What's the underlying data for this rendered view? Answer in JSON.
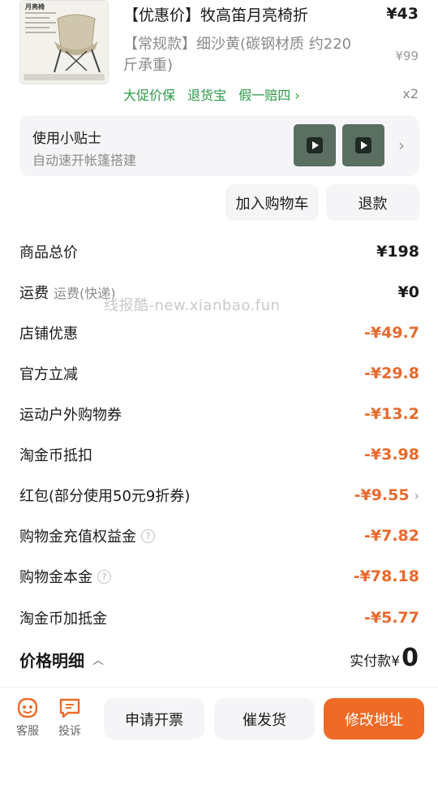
{
  "product": {
    "thumb_title": "月亮椅",
    "title": "【优惠价】牧高笛月亮椅折",
    "price": "¥43",
    "variant": "【常规款】细沙黄(碳钢材质 约220斤承重)",
    "original_price": "¥99",
    "tags": [
      "大促价保",
      "退货宝",
      "假一赔四 ›"
    ],
    "quantity": "x2"
  },
  "tips": {
    "title": "使用小贴士",
    "subtitle": "自动速开帐篷搭建"
  },
  "actions": {
    "add_cart": "加入购物车",
    "refund": "退款"
  },
  "price_rows": [
    {
      "label": "商品总价",
      "value": "¥198"
    },
    {
      "label": "运费",
      "sub": "运费(快递)",
      "value": "¥0"
    },
    {
      "label": "店铺优惠",
      "value": "-¥49.7"
    },
    {
      "label": "官方立减",
      "value": "-¥29.8"
    },
    {
      "label": "运动户外购物券",
      "value": "-¥13.2"
    },
    {
      "label": "淘金币抵扣",
      "value": "-¥3.98"
    },
    {
      "label": "红包(部分使用50元9折券)",
      "value": "-¥9.55"
    },
    {
      "label": "购物金充值权益金",
      "value": "-¥7.82"
    },
    {
      "label": "购物金本金",
      "value": "-¥78.18"
    },
    {
      "label": "淘金币加抵金",
      "value": "-¥5.77"
    }
  ],
  "watermark": "线报酷-new.xianbao.fun",
  "detail": {
    "title": "价格明细",
    "paid_label": "实付款¥",
    "paid_value": "0"
  },
  "bottom": {
    "service": "客服",
    "complaint": "投诉",
    "invoice": "申请开票",
    "urge": "催发货",
    "modify_address": "修改地址"
  },
  "colors": {
    "accent": "#ee6a26",
    "discount": "#e8692c",
    "tag_green": "#2a9a48"
  }
}
